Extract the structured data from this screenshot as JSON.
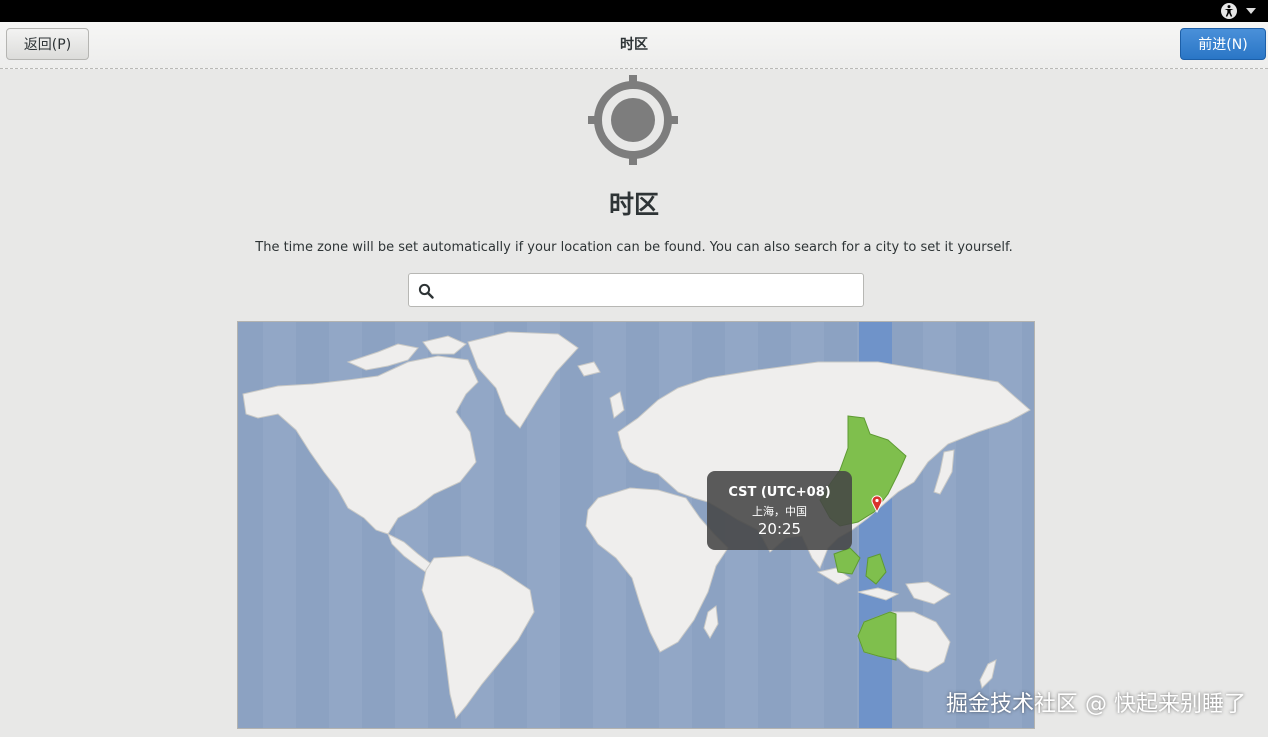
{
  "topbar": {
    "a11y_icon": "accessibility-icon",
    "menu_icon": "chevron-down-icon"
  },
  "header": {
    "back_label": "返回(P)",
    "title": "时区",
    "next_label": "前进(N)"
  },
  "page": {
    "icon": "location-crosshair-icon",
    "title": "时区",
    "description": "The time zone will be set automatically if your location can be found. You can also search for a city to set it yourself."
  },
  "search": {
    "value": "",
    "placeholder": "",
    "icon": "search-icon"
  },
  "map": {
    "tooltip": {
      "timezone": "CST (UTC+08)",
      "city": "上海，中国",
      "time": "20:25"
    },
    "pin_icon": "location-pin-icon",
    "colors": {
      "ocean": "#92a7c6",
      "land": "#efeeed",
      "selected_zone": "#7fbf4d",
      "selected_band": "#6f93c9"
    }
  },
  "watermark": "掘金技术社区 @ 快起来别睡了"
}
